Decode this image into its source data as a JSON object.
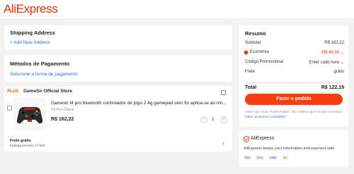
{
  "header": {
    "logo": "AliExpress"
  },
  "shipping": {
    "title": "Shipping Address",
    "add_link": "+ Add New Address"
  },
  "payment": {
    "title": "Métodos de Pagamento",
    "select_link": "Selecione a forma de pagamento"
  },
  "store": {
    "badge": "PLUS",
    "name": "GameSir Official Store",
    "product": {
      "title": "Gamesir t4 pro bluetooth controlador de jogo 2.4g gamepad sem fio aplica-se ao nintendo...",
      "variant": "T4 Pro,China",
      "price": "R$ 162,22",
      "quantity": "1",
      "minus": "−",
      "plus": "+"
    },
    "shipping_label": "Frete grátis",
    "shipping_estimate": "Entrega prevista: 17 Dez",
    "chevron": "›"
  },
  "summary": {
    "title": "Resumo",
    "rows": [
      {
        "label": "Subtotal",
        "value": "R$ 162,22"
      },
      {
        "label": "Economia",
        "value": "-R$ 40,00 ⌄"
      },
      {
        "label": "Código Promocional",
        "value": "Enter code here ⌄"
      },
      {
        "label": "Frete",
        "value": "grátis"
      }
    ],
    "total_label": "Total",
    "total_value": "R$ 122,19",
    "order_button": "Fazer o pedido",
    "terms_prefix": "Assim que clicar \"Fazer Pedido\", Eu confirmo que li e que reconheço ",
    "terms_link": "todos os termos e condições",
    "terms_suffix": "."
  },
  "safety": {
    "title": "AliExpress",
    "text": "AliExpress keeps your information and payment safe",
    "badges": [
      "PCI",
      "DSS",
      "VISA",
      "MC"
    ]
  },
  "colors": {
    "brand": "#e62e04",
    "button": "#fd3d11",
    "link": "#1a73e8"
  }
}
